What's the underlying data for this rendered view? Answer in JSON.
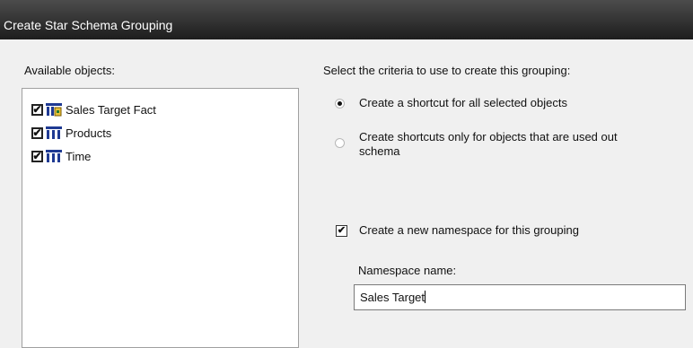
{
  "window": {
    "title": "Create Star Schema Grouping"
  },
  "available": {
    "label": "Available objects:",
    "items": [
      {
        "label": "Sales Target Fact",
        "checked": true,
        "icon": "fact-table-icon",
        "check_mark": "✔"
      },
      {
        "label": "Products",
        "checked": true,
        "icon": "dimension-table-icon",
        "check_mark": "✔"
      },
      {
        "label": "Time",
        "checked": true,
        "icon": "dimension-table-icon",
        "check_mark": "✔"
      }
    ]
  },
  "criteria": {
    "label": "Select the criteria to use to create this grouping:",
    "options": [
      {
        "label": "Create a shortcut for all selected objects",
        "selected": true
      },
      {
        "label_line1": "Create shortcuts only for objects that are used out",
        "label_line2": "schema",
        "selected": false
      }
    ]
  },
  "namespace": {
    "checkbox_label": "Create a new namespace for this grouping",
    "checked": true,
    "check_mark": "✔",
    "name_label": "Namespace name:",
    "name_value": "Sales Target"
  }
}
